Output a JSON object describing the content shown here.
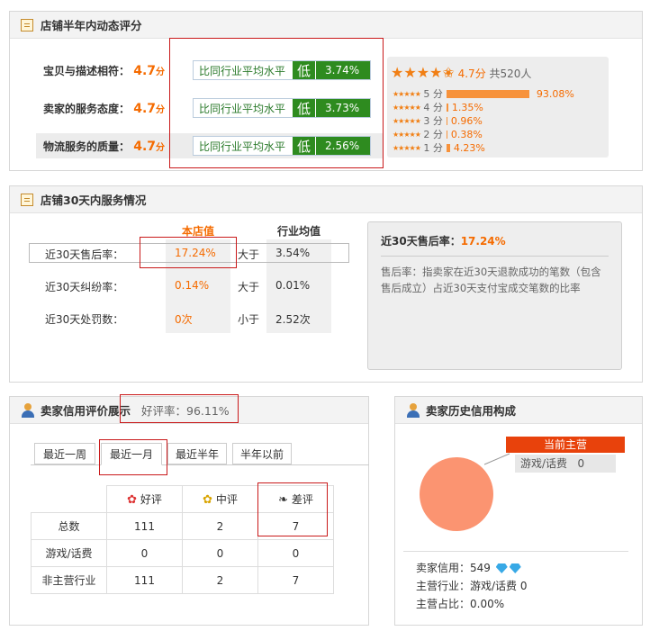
{
  "dsr": {
    "title": "店铺半年内动态评分",
    "rows": [
      {
        "label": "宝贝与描述相符：",
        "score": "4.7",
        "unit": "分",
        "compare": "比同行业平均水平",
        "level": "低",
        "pct": "3.74%"
      },
      {
        "label": "卖家的服务态度：",
        "score": "4.7",
        "unit": "分",
        "compare": "比同行业平均水平",
        "level": "低",
        "pct": "3.73%"
      },
      {
        "label": "物流服务的质量：",
        "score": "4.7",
        "unit": "分",
        "compare": "比同行业平均水平",
        "level": "低",
        "pct": "2.56%"
      }
    ],
    "summary_score": "4.7分",
    "summary_count": "共520人",
    "distribution": [
      {
        "label": "5 分",
        "pct": "93.08%",
        "fraction": 0.9308
      },
      {
        "label": "4 分",
        "pct": "1.35%",
        "fraction": 0.0135
      },
      {
        "label": "3 分",
        "pct": "0.96%",
        "fraction": 0.0096
      },
      {
        "label": "2 分",
        "pct": "0.38%",
        "fraction": 0.0038
      },
      {
        "label": "1 分",
        "pct": "4.23%",
        "fraction": 0.0423
      }
    ]
  },
  "service": {
    "title": "店铺30天内服务情况",
    "col_store": "本店值",
    "col_industry": "行业均值",
    "rows": [
      {
        "label": "近30天售后率：",
        "store": "17.24%",
        "cmp": "大于",
        "industry": "3.54%"
      },
      {
        "label": "近30天纠纷率：",
        "store": "0.14%",
        "cmp": "大于",
        "industry": "0.01%"
      },
      {
        "label": "近30天处罚数：",
        "store": "0次",
        "cmp": "小于",
        "industry": "2.52次"
      }
    ],
    "tip_title": "近30天售后率：",
    "tip_value": "17.24%",
    "tip_body": "售后率：指卖家在近30天退款成功的笔数（包含售后成立）占近30天支付宝成交笔数的比率"
  },
  "credit": {
    "title": "卖家信用评价展示",
    "good_rate": "好评率：96.11%",
    "tabs": [
      "最近一周",
      "最近一月",
      "最近半年",
      "半年以前"
    ],
    "active_tab": 1,
    "headers": [
      "好评",
      "中评",
      "差评"
    ],
    "rows": [
      {
        "label": "总数",
        "good": "111",
        "mid": "2",
        "bad": "7"
      },
      {
        "label": "游戏/话费",
        "good": "0",
        "mid": "0",
        "bad": "0"
      },
      {
        "label": "非主营行业",
        "good": "111",
        "mid": "2",
        "bad": "7"
      }
    ]
  },
  "history": {
    "title": "卖家历史信用构成",
    "legend_head": "当前主营",
    "legend_item": "游戏/话费",
    "legend_value": "0",
    "credit_label": "卖家信用：",
    "credit_value": "549",
    "main_industry_label": "主营行业：",
    "main_industry_value": "游戏/话费 0",
    "main_share_label": "主营占比：",
    "main_share_value": "0.00%"
  },
  "colors": {
    "accent": "#f56b00",
    "low_green": "#2e8b1f",
    "highlight_red": "#c9191a",
    "pie": "#fb9471"
  }
}
